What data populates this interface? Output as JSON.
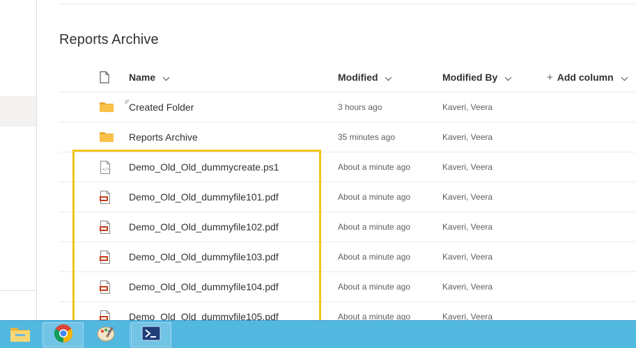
{
  "library": {
    "title": "Reports Archive"
  },
  "columns": {
    "name": "Name",
    "modified": "Modified",
    "modified_by": "Modified By",
    "add_column": "Add column"
  },
  "rows": [
    {
      "type": "folder",
      "icon": "folder-icon",
      "name": "Created Folder",
      "modified": "3 hours ago",
      "modified_by": "Kaveri, Veera",
      "loading": true
    },
    {
      "type": "folder",
      "icon": "folder-icon",
      "name": "Reports Archive",
      "modified": "35 minutes ago",
      "modified_by": "Kaveri, Veera"
    },
    {
      "type": "script",
      "icon": "script-file-icon",
      "name": "Demo_Old_Old_dummycreate.ps1",
      "modified": "About a minute ago",
      "modified_by": "Kaveri, Veera"
    },
    {
      "type": "pdf",
      "icon": "pdf-file-icon",
      "name": "Demo_Old_Old_dummyfile101.pdf",
      "modified": "About a minute ago",
      "modified_by": "Kaveri, Veera"
    },
    {
      "type": "pdf",
      "icon": "pdf-file-icon",
      "name": "Demo_Old_Old_dummyfile102.pdf",
      "modified": "About a minute ago",
      "modified_by": "Kaveri, Veera"
    },
    {
      "type": "pdf",
      "icon": "pdf-file-icon",
      "name": "Demo_Old_Old_dummyfile103.pdf",
      "modified": "About a minute ago",
      "modified_by": "Kaveri, Veera"
    },
    {
      "type": "pdf",
      "icon": "pdf-file-icon",
      "name": "Demo_Old_Old_dummyfile104.pdf",
      "modified": "About a minute ago",
      "modified_by": "Kaveri, Veera"
    },
    {
      "type": "pdf",
      "icon": "pdf-file-icon",
      "name": "Demo_Old_Old_dummyfile105.pdf",
      "modified": "About a minute ago",
      "modified_by": "Kaveri, Veera"
    }
  ],
  "colors": {
    "highlight": "#f5c518",
    "folder": "#f8c24a",
    "pdf": "#c43e1c",
    "taskbar": "#52b8e0"
  },
  "taskbar": {
    "items": [
      "file-explorer-icon",
      "chrome-icon",
      "paint-icon",
      "powershell-icon"
    ]
  }
}
